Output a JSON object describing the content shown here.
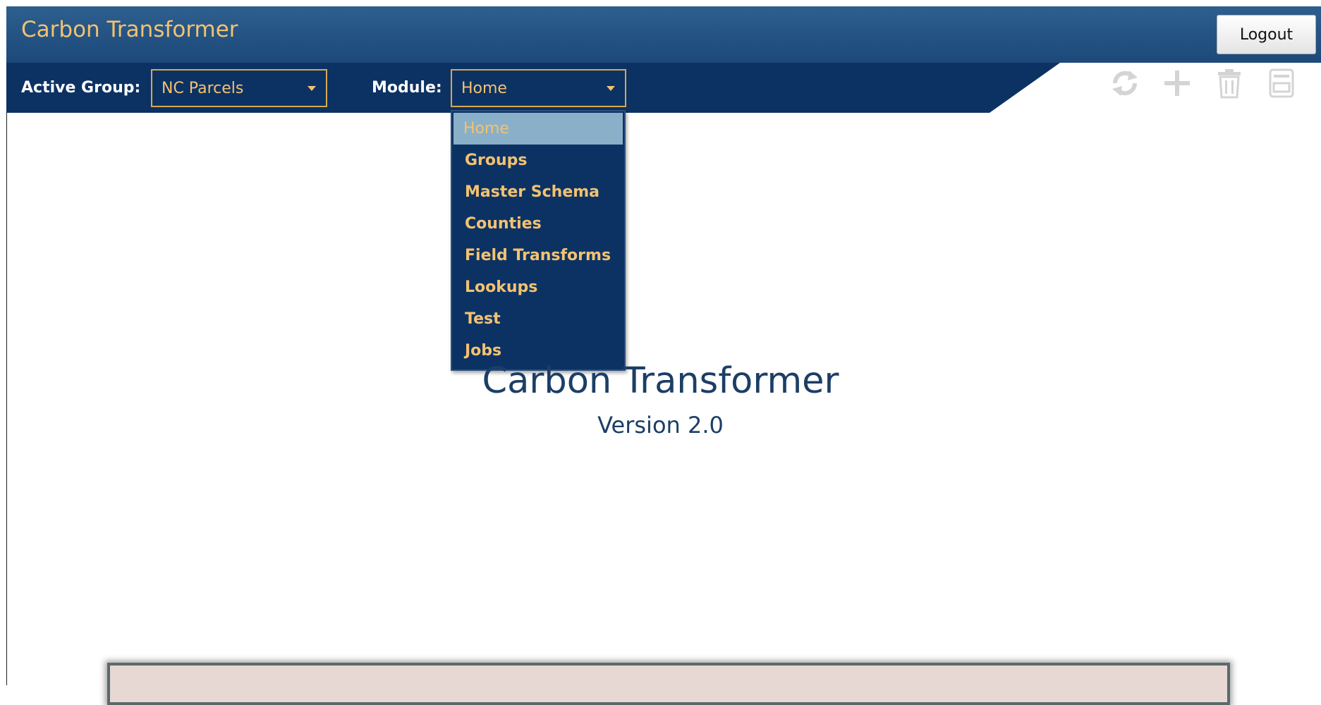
{
  "header": {
    "app_title": "Carbon Transformer",
    "logout_label": "Logout",
    "active_group_label": "Active Group:",
    "active_group_value": "NC Parcels",
    "module_label": "Module:",
    "module_value": "Home"
  },
  "toolbar": {
    "icons": [
      "refresh-icon",
      "add-icon",
      "delete-icon",
      "save-icon"
    ]
  },
  "module_menu": {
    "items": [
      "Home",
      "Groups",
      "Master Schema",
      "Counties",
      "Field Transforms",
      "Lookups",
      "Test",
      "Jobs"
    ],
    "selected": "Home"
  },
  "main": {
    "title": "Carbon Transformer",
    "version": "Version 2.0"
  },
  "colors": {
    "header_navy": "#0c3264",
    "accent_gold": "#f3c270",
    "highlight": "#8ab0c9",
    "text_navy": "#1c3e66",
    "icon_gray": "#d4d4d4"
  }
}
